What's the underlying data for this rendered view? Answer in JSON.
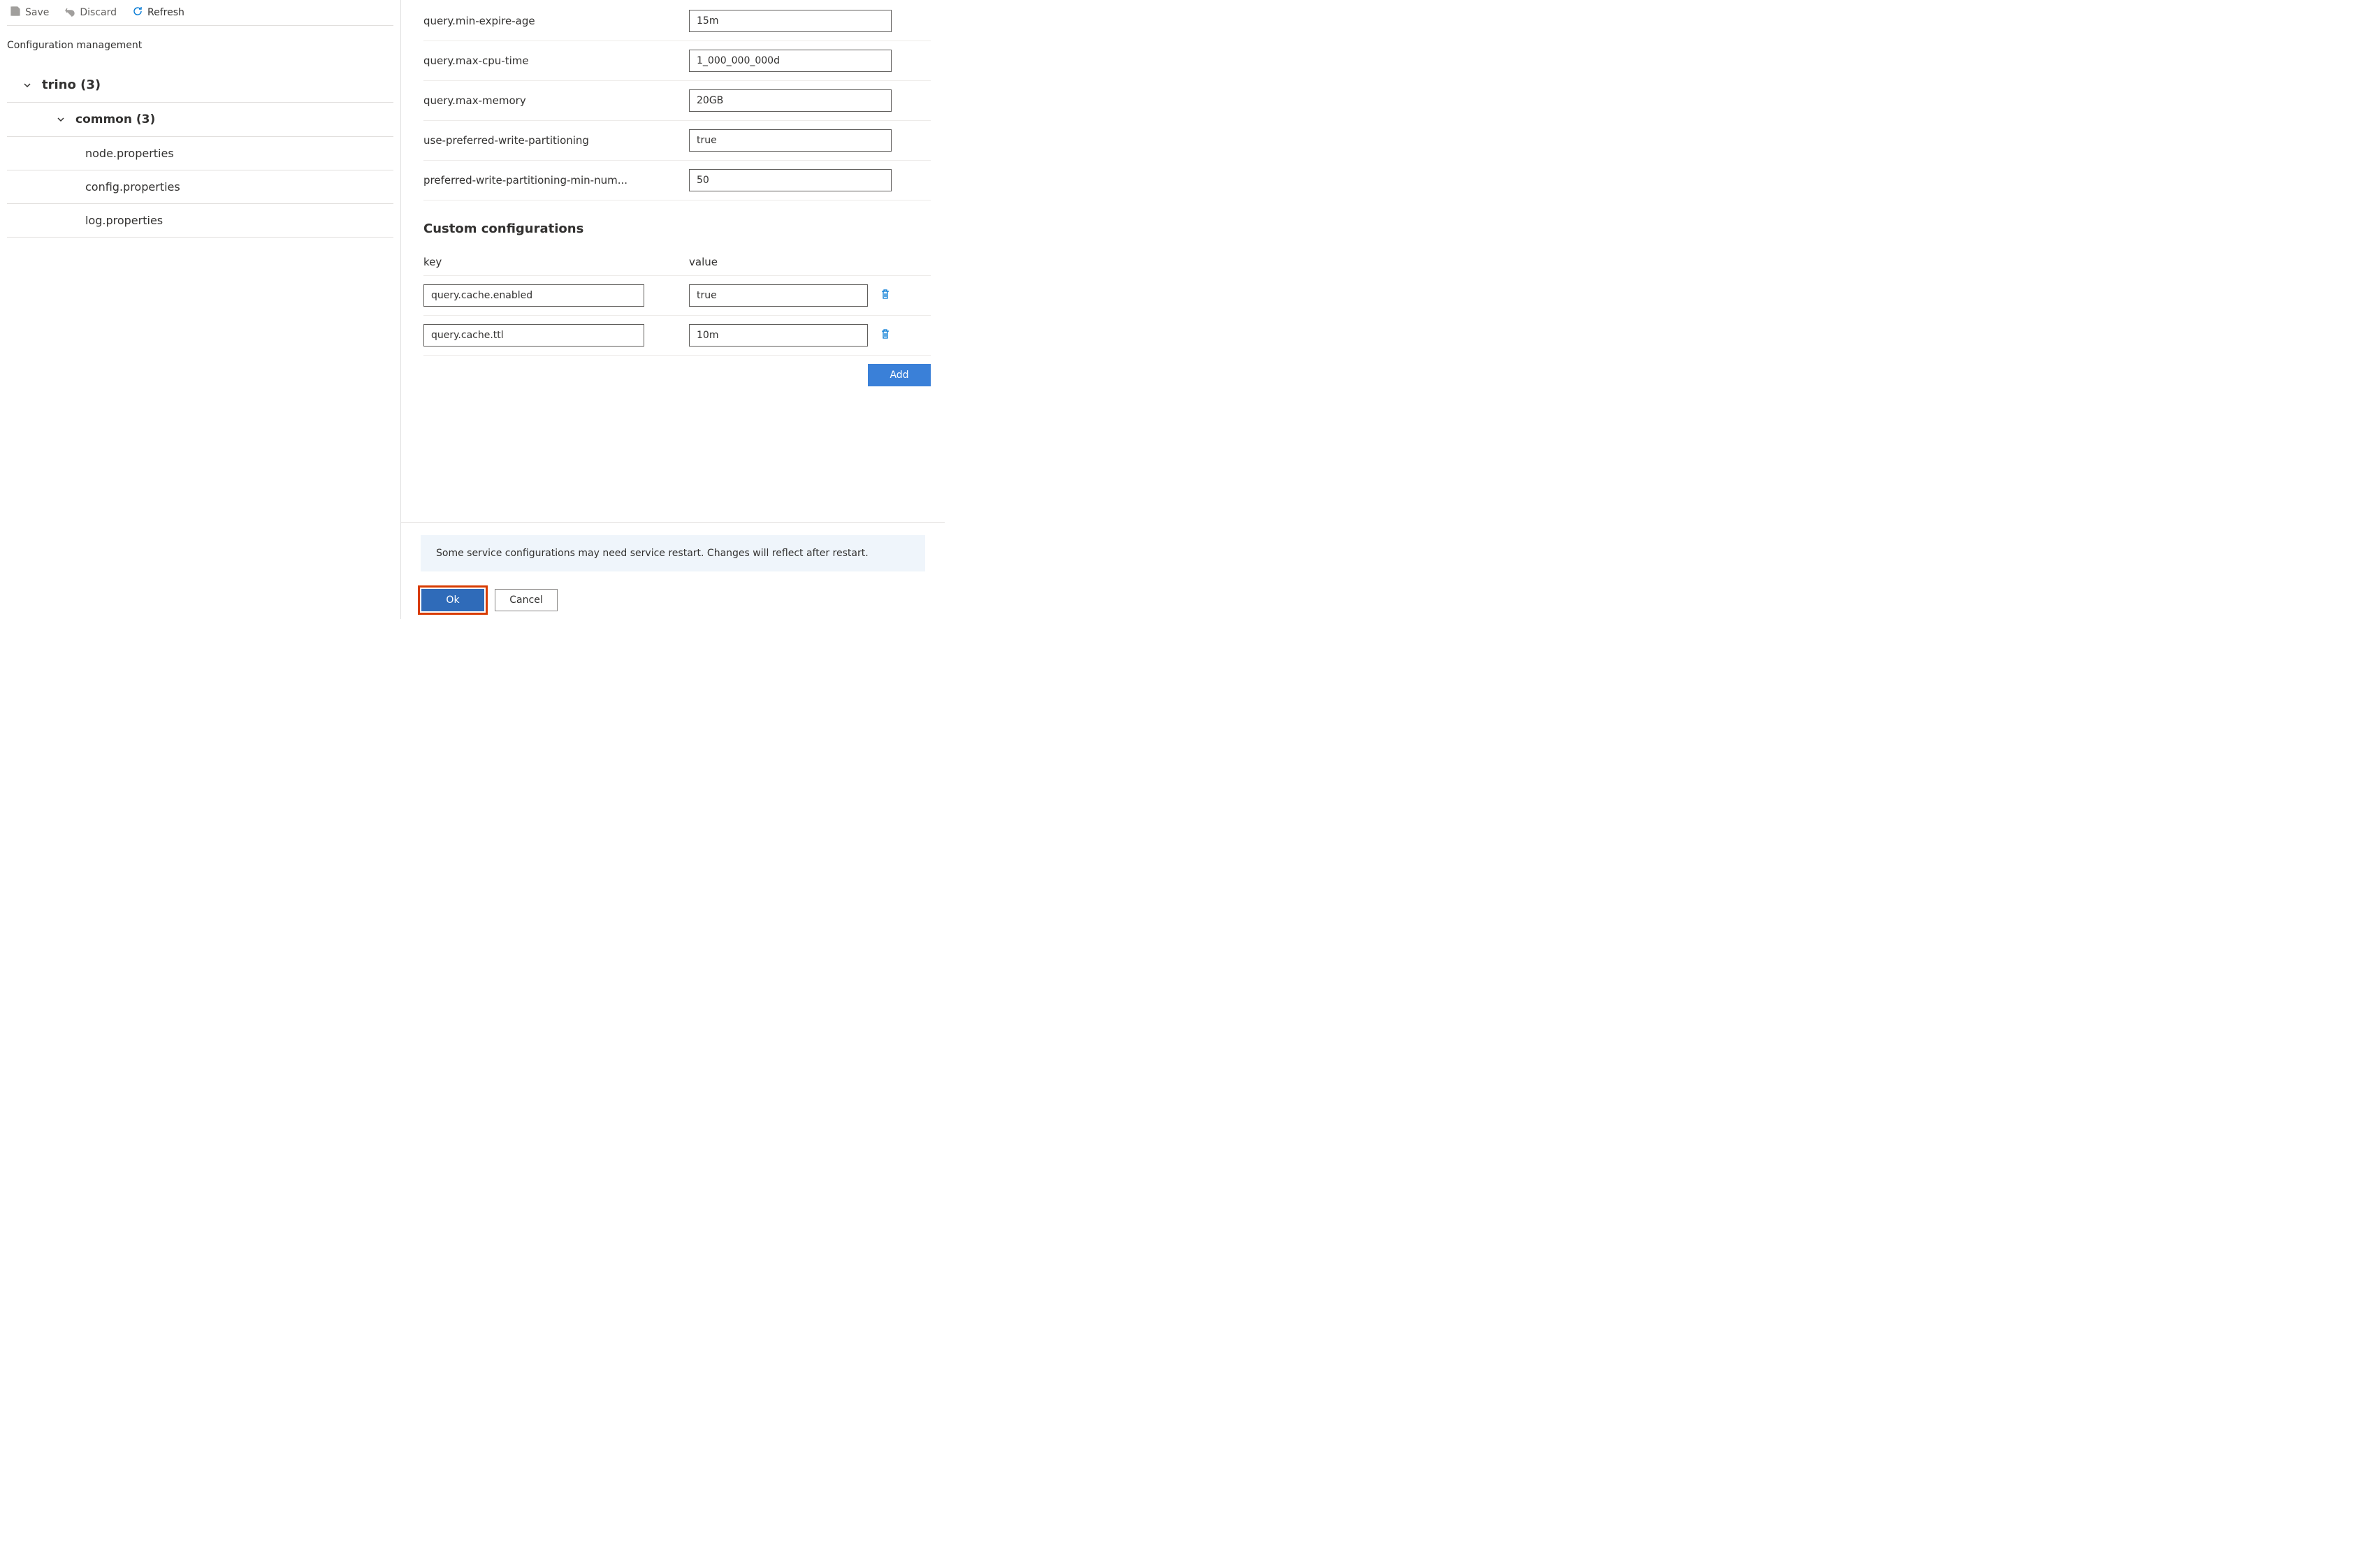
{
  "toolbar": {
    "save": "Save",
    "discard": "Discard",
    "refresh": "Refresh"
  },
  "section_title": "Configuration management",
  "tree": {
    "group1": "trino (3)",
    "group2": "common (3)",
    "items": [
      "node.properties",
      "config.properties",
      "log.properties"
    ]
  },
  "props": [
    {
      "label": "query.min-expire-age",
      "value": "15m"
    },
    {
      "label": "query.max-cpu-time",
      "value": "1_000_000_000d"
    },
    {
      "label": "query.max-memory",
      "value": "20GB"
    },
    {
      "label": "use-preferred-write-partitioning",
      "value": "true"
    },
    {
      "label": "preferred-write-partitioning-min-num...",
      "value": "50"
    }
  ],
  "custom_section": "Custom configurations",
  "kv_headers": {
    "key": "key",
    "value": "value"
  },
  "custom": [
    {
      "key": "query.cache.enabled",
      "value": "true"
    },
    {
      "key": "query.cache.ttl",
      "value": "10m"
    }
  ],
  "add_label": "Add",
  "banner": "Some service configurations may need service restart. Changes will reflect after restart.",
  "ok": "Ok",
  "cancel": "Cancel"
}
